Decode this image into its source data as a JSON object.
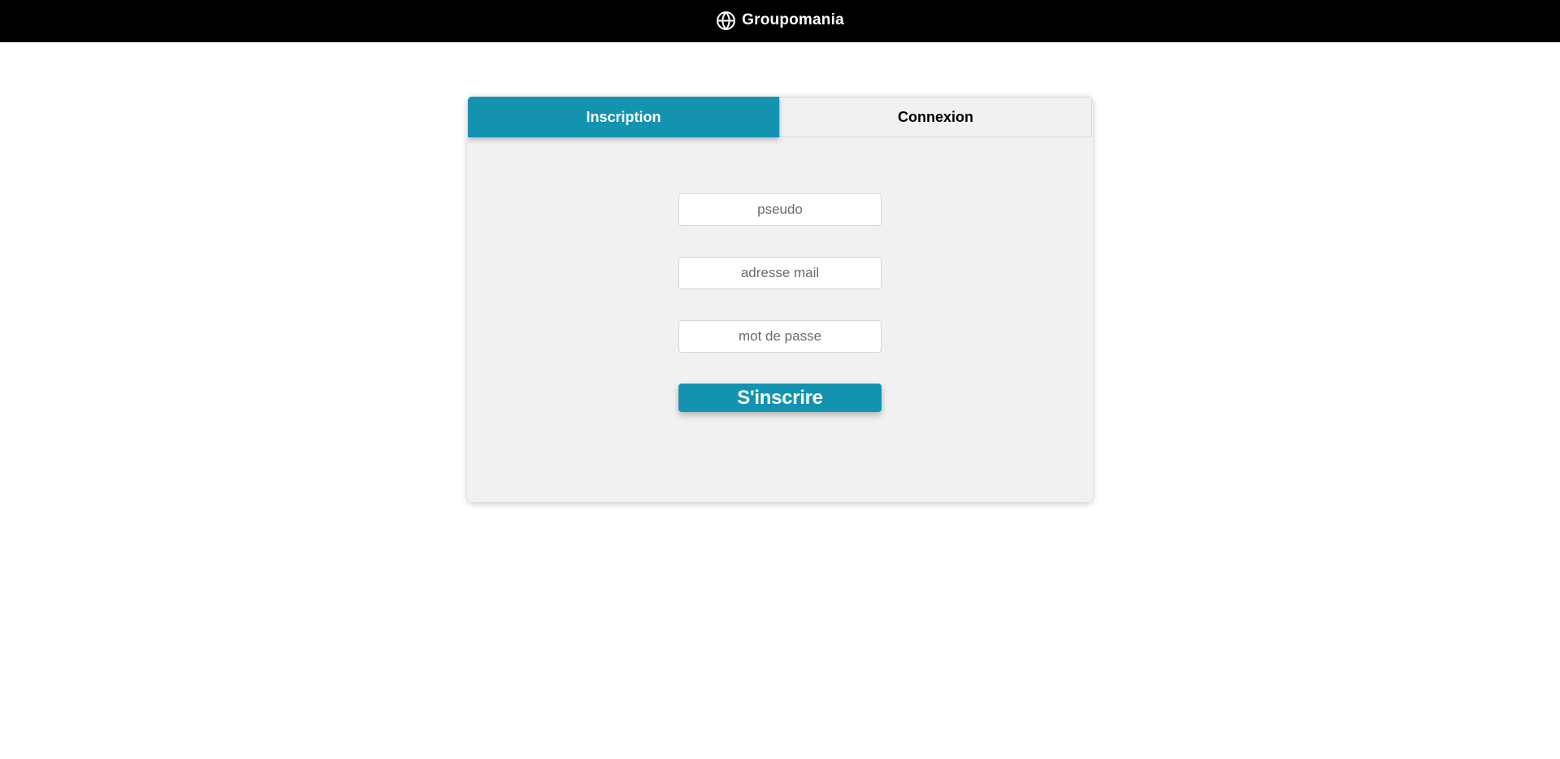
{
  "header": {
    "brand_name": "Groupomania",
    "brand_icon": "globe-icon",
    "background_color": "#000000"
  },
  "auth_card": {
    "tabs": [
      {
        "label": "Inscription",
        "active": true
      },
      {
        "label": "Connexion",
        "active": false
      }
    ],
    "fields": {
      "username": {
        "placeholder": "pseudo",
        "value": ""
      },
      "email": {
        "placeholder": "adresse mail",
        "value": ""
      },
      "password": {
        "placeholder": "mot de passe",
        "value": ""
      }
    },
    "submit_label": "S'inscrire"
  },
  "colors": {
    "accent": "#1393b0",
    "card_background": "#f1f1f1"
  }
}
